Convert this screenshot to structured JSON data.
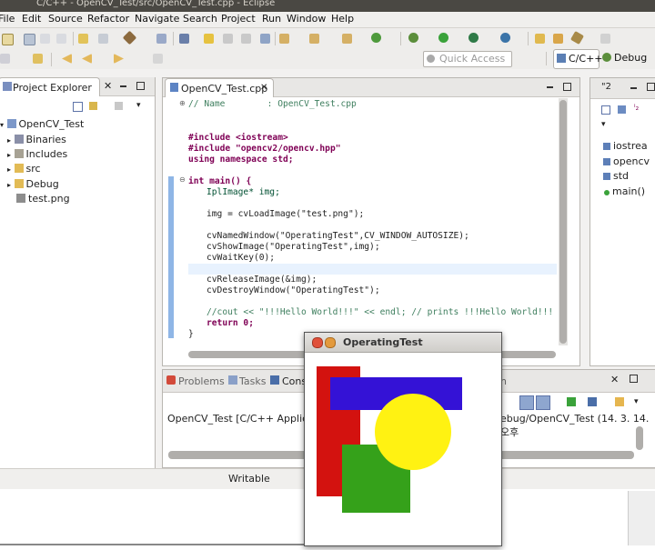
{
  "window": {
    "title": "C/C++ - OpenCV_Test/src/OpenCV_Test.cpp - Eclipse"
  },
  "menu": [
    "File",
    "Edit",
    "Source",
    "Refactor",
    "Navigate",
    "Search",
    "Project",
    "Run",
    "Window",
    "Help"
  ],
  "quick_access": {
    "placeholder": "Quick Access"
  },
  "perspectives": {
    "cpp": "C/C++",
    "debug": "Debug"
  },
  "project_explorer": {
    "title": "Project Explorer",
    "items": [
      {
        "label": "OpenCV_Test",
        "icon": "project-icon"
      },
      {
        "label": "Binaries",
        "icon": "binaries-icon"
      },
      {
        "label": "Includes",
        "icon": "includes-icon"
      },
      {
        "label": "src",
        "icon": "folder-icon"
      },
      {
        "label": "Debug",
        "icon": "folder-icon"
      },
      {
        "label": "test.png",
        "icon": "image-file-icon"
      }
    ]
  },
  "editor": {
    "tab": "OpenCV_Test.cpp",
    "lines": {
      "l1": "// Name        : OpenCV_Test.cpp",
      "l2": "#include <iostream>",
      "l3": "#include \"opencv2/opencv.hpp\"",
      "l4": "using namespace std;",
      "l5": "int main() {",
      "l6": "IplImage* img;",
      "l7": "img = cvLoadImage(\"test.png\");",
      "l8": "cvNamedWindow(\"OperatingTest\",CV_WINDOW_AUTOSIZE);",
      "l9": "cvShowImage(\"OperatingTest\",img);",
      "l10": "cvWaitKey(0);",
      "l11": "cvReleaseImage(&img);",
      "l12": "cvDestroyWindow(\"OperatingTest\");",
      "l13": "//cout << \"!!!Hello World!!!\" << endl; // prints !!!Hello World!!!",
      "l14": "return 0;",
      "l15": "}"
    }
  },
  "outline": {
    "title": "\"2",
    "items": [
      "iostrea",
      "opencv",
      "std",
      "main()"
    ]
  },
  "bottom": {
    "tabs": {
      "problems": "Problems",
      "tasks": "Tasks",
      "console": "Cons",
      "search": "ch"
    },
    "console_left": "OpenCV_Test [C/C++ Application",
    "console_right": "ebug/OpenCV_Test (14. 3. 14. 오후"
  },
  "status": {
    "writable": "Writable"
  },
  "popup": {
    "title": "OperatingTest"
  }
}
